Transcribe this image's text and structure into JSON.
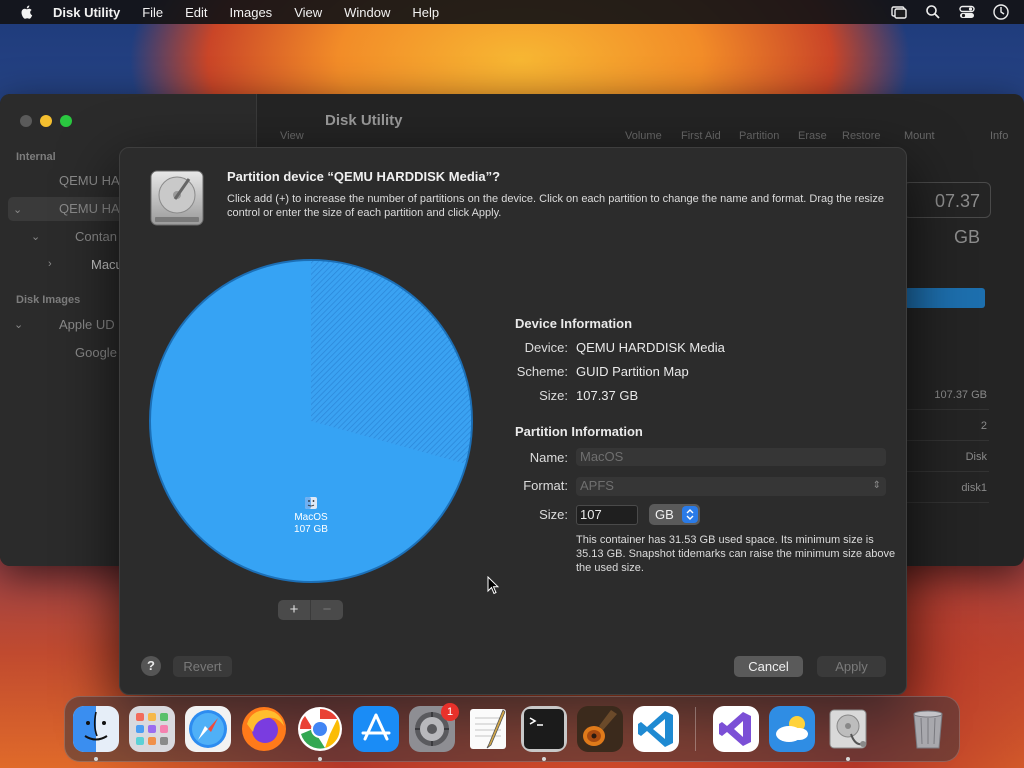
{
  "menubar": {
    "app_name": "Disk Utility",
    "items": [
      "File",
      "Edit",
      "Images",
      "View",
      "Window",
      "Help"
    ]
  },
  "main_window": {
    "title": "Disk Utility",
    "sidebar": {
      "section_internal": "Internal",
      "section_disk_images": "Disk Images",
      "rows": [
        "QEMU HA",
        "QEMU HA",
        "Contan",
        "Macu",
        "Apple UD",
        "Google"
      ]
    },
    "toolbar": [
      "View",
      "Volume",
      "First Aid",
      "Partition",
      "Erase",
      "Restore",
      "Mount",
      "Info"
    ],
    "capacity": "07.37 GB",
    "info_values": [
      "107.37 GB",
      "2",
      "Disk",
      "disk1"
    ]
  },
  "sheet": {
    "title": "Partition device “QEMU HARDDISK Media”?",
    "description": "Click add (+) to increase the number of partitions on the device. Click on each partition to change the name and format. Drag the resize control or enter the size of each partition and click Apply.",
    "pie": {
      "partition_name": "MacOS",
      "partition_size": "107 GB",
      "used_fraction": 0.293
    },
    "add_button": "+",
    "remove_button": "−",
    "device_info": {
      "heading": "Device Information",
      "device_label": "Device:",
      "device_value": "QEMU HARDDISK Media",
      "scheme_label": "Scheme:",
      "scheme_value": "GUID Partition Map",
      "size_label": "Size:",
      "size_value": "107.37 GB"
    },
    "partition_info": {
      "heading": "Partition Information",
      "name_label": "Name:",
      "name_value": "MacOS",
      "format_label": "Format:",
      "format_value": "APFS",
      "size_label": "Size:",
      "size_value": "107",
      "size_unit": "GB",
      "note": "This container has 31.53 GB used space. Its minimum size is 35.13 GB. Snapshot tidemarks can raise the minimum size above the used size."
    },
    "help_button": "?",
    "revert_button": "Revert",
    "cancel_button": "Cancel",
    "apply_button": "Apply"
  },
  "dock": {
    "apps": [
      "finder-icon",
      "launchpad-icon",
      "safari-icon",
      "firefox-icon",
      "chrome-icon",
      "app-store-icon",
      "system-preferences-icon",
      "textedit-icon",
      "terminal-icon",
      "garageband-icon",
      "vscode-icon",
      "visual-studio-icon",
      "weather-icon",
      "disk-utility-icon",
      "trash-icon"
    ],
    "system_preferences_badge": "1"
  },
  "colors": {
    "accent_blue": "#2a7be8",
    "pie_blue": "#2f9bf0",
    "traffic_yellow": "#f5bf2f",
    "traffic_green": "#2ac840"
  }
}
